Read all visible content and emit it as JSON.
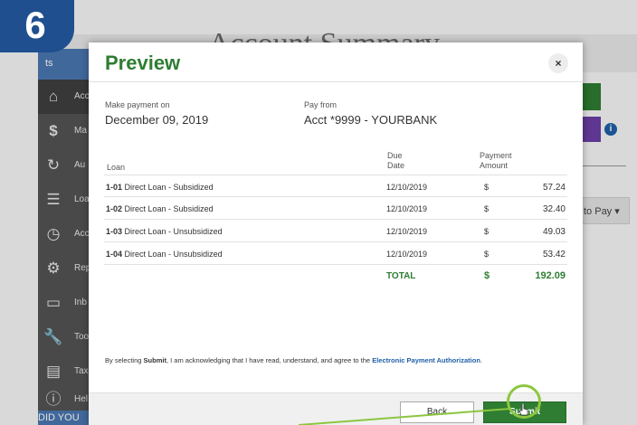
{
  "step_badge": "6",
  "background": {
    "title": "Account Summary",
    "sidebar_top": "ts",
    "sidebar_items": [
      {
        "icon": "home-icon",
        "label": "Acc",
        "active": true
      },
      {
        "icon": "dollar-icon",
        "label": "Ma"
      },
      {
        "icon": "autopay-icon",
        "label": "Au"
      },
      {
        "icon": "list-icon",
        "label": "Loa"
      },
      {
        "icon": "clock-icon",
        "label": "Acc"
      },
      {
        "icon": "gear-icon",
        "label": "Rep"
      },
      {
        "icon": "inbox-icon",
        "label": "Inb"
      },
      {
        "icon": "wrench-icon",
        "label": "Too"
      },
      {
        "icon": "document-icon",
        "label": "Tax"
      },
      {
        "icon": "help-icon",
        "label": "Hel"
      }
    ],
    "did_you": "DID YOU",
    "pay_button": "to Pay ▾",
    "info_icon": "i"
  },
  "modal": {
    "title": "Preview",
    "close": "×",
    "make_payment_label": "Make payment on",
    "make_payment_value": "December 09, 2019",
    "pay_from_label": "Pay from",
    "pay_from_value": "Acct *9999 - YOURBANK",
    "columns": {
      "loan": "Loan",
      "due_1": "Due",
      "due_2": "Date",
      "payment_1": "Payment",
      "payment_2": "Amount"
    },
    "rows": [
      {
        "code": "1-01",
        "desc": "Direct Loan - Subsidized",
        "due": "12/10/2019",
        "cur": "$",
        "amount": "57.24"
      },
      {
        "code": "1-02",
        "desc": "Direct Loan - Subsidized",
        "due": "12/10/2019",
        "cur": "$",
        "amount": "32.40"
      },
      {
        "code": "1-03",
        "desc": "Direct Loan - Unsubsidized",
        "due": "12/10/2019",
        "cur": "$",
        "amount": "49.03"
      },
      {
        "code": "1-04",
        "desc": "Direct Loan - Unsubsidized",
        "due": "12/10/2019",
        "cur": "$",
        "amount": "53.42"
      }
    ],
    "total_label": "TOTAL",
    "total_cur": "$",
    "total_amount": "192.09",
    "ack_prefix": "By selecting ",
    "ack_bold": "Submit",
    "ack_middle": ", I am acknowledging that I have read, understand, and agree to the ",
    "ack_link": "Electronic Payment Authorization",
    "ack_suffix": ".",
    "back": "Back",
    "submit": "Submit"
  },
  "colors": {
    "accent_green": "#2e7d32",
    "highlight": "#8cc63f",
    "badge": "#1f4f8f"
  }
}
